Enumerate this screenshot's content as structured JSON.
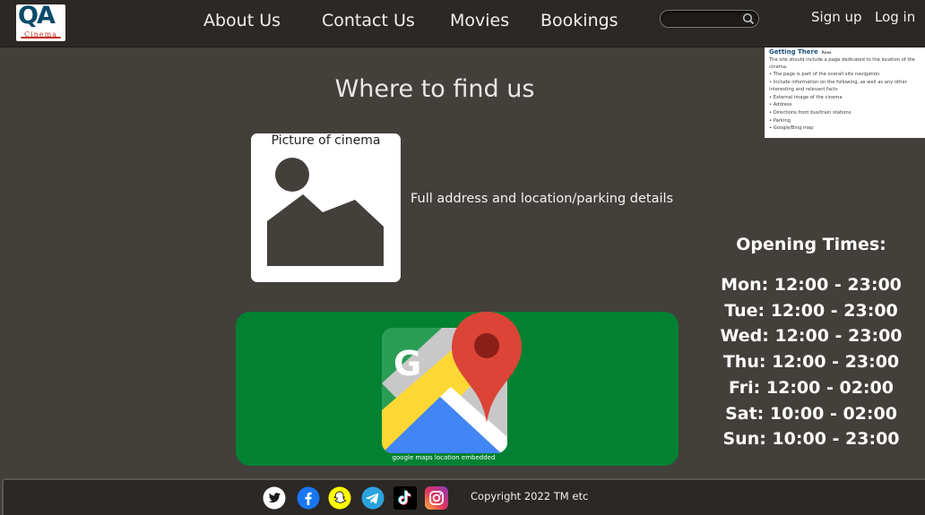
{
  "header": {
    "logo": {
      "main": "QA",
      "sub": "Cinema"
    },
    "nav": [
      {
        "label": "About Us"
      },
      {
        "label": "Contact Us"
      },
      {
        "label": "Movies"
      },
      {
        "label": "Bookings"
      }
    ],
    "search": {
      "placeholder": "",
      "value": ""
    },
    "auth": {
      "sign_up": "Sign up",
      "log_in": "Log in"
    }
  },
  "note": {
    "title": "Getting There",
    "author": "Ross",
    "intro": "The site should include a page dedicated to the location of the cinema.",
    "items": [
      "The page is part of the overall site navigation",
      "Include information on the following, as well as any other interesting and relevant facts",
      "External image of the cinema",
      "Address",
      "Directions from bus/train stations",
      "Parking",
      "Google/Bing map"
    ]
  },
  "main": {
    "title": "Where to find us",
    "picture_label": "Picture of cinema",
    "address_text": "Full address and location/parking details",
    "map_caption": "google maps location embedded"
  },
  "hours": {
    "title": "Opening Times:",
    "rows": [
      "Mon: 12:00 - 23:00",
      "Tue: 12:00 - 23:00",
      "Wed: 12:00 - 23:00",
      "Thu: 12:00 - 23:00",
      "Fri: 12:00 - 02:00",
      "Sat: 10:00 - 02:00",
      "Sun: 10:00 - 23:00"
    ]
  },
  "footer": {
    "social": [
      {
        "icon": "twitter-icon",
        "color": "#1da1f2"
      },
      {
        "icon": "facebook-icon",
        "color": "#1877f2"
      },
      {
        "icon": "snapchat-icon",
        "color": "#fffc00"
      },
      {
        "icon": "telegram-icon",
        "color": "#2aa3df"
      },
      {
        "icon": "tiktok-icon",
        "color": "#000000"
      },
      {
        "icon": "instagram-icon",
        "color": "#d6249f"
      }
    ],
    "copyright": "Copyright 2022 TM etc"
  },
  "colors": {
    "background": "#433f3b",
    "header": "#2b2825",
    "map_background": "#038132"
  }
}
